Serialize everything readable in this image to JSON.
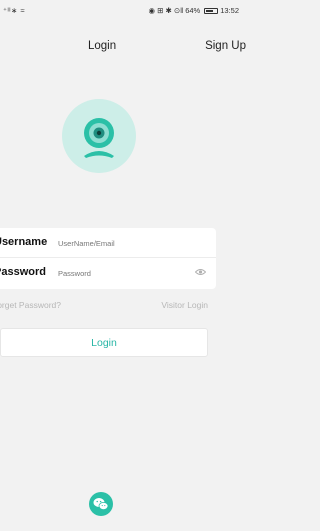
{
  "status_bar": {
    "signal": "⁺ᴵᴵ∗ ≈",
    "icons": "◉ ⊞ ✱ ⊙‖",
    "battery_percent": "64%",
    "battery_level": 64,
    "time": "13:52"
  },
  "nav": {
    "title": "Login",
    "signup_label": "Sign Up"
  },
  "logo": {
    "icon": "camera-icon",
    "color": "#2bc0a7"
  },
  "form": {
    "username_label": "Username",
    "username_placeholder": "UserName/Email",
    "password_label": "Password",
    "password_placeholder": "Password",
    "password_toggle_icon": "eye-icon"
  },
  "links": {
    "forgot": "Forget Password?",
    "visitor": "Visitor Login"
  },
  "login_button_label": "Login",
  "social": {
    "icon": "wechat-icon"
  },
  "colors": {
    "background": "#f2f2f2",
    "accent": "#2bc0a7",
    "muted_text": "#b7b7b7"
  }
}
